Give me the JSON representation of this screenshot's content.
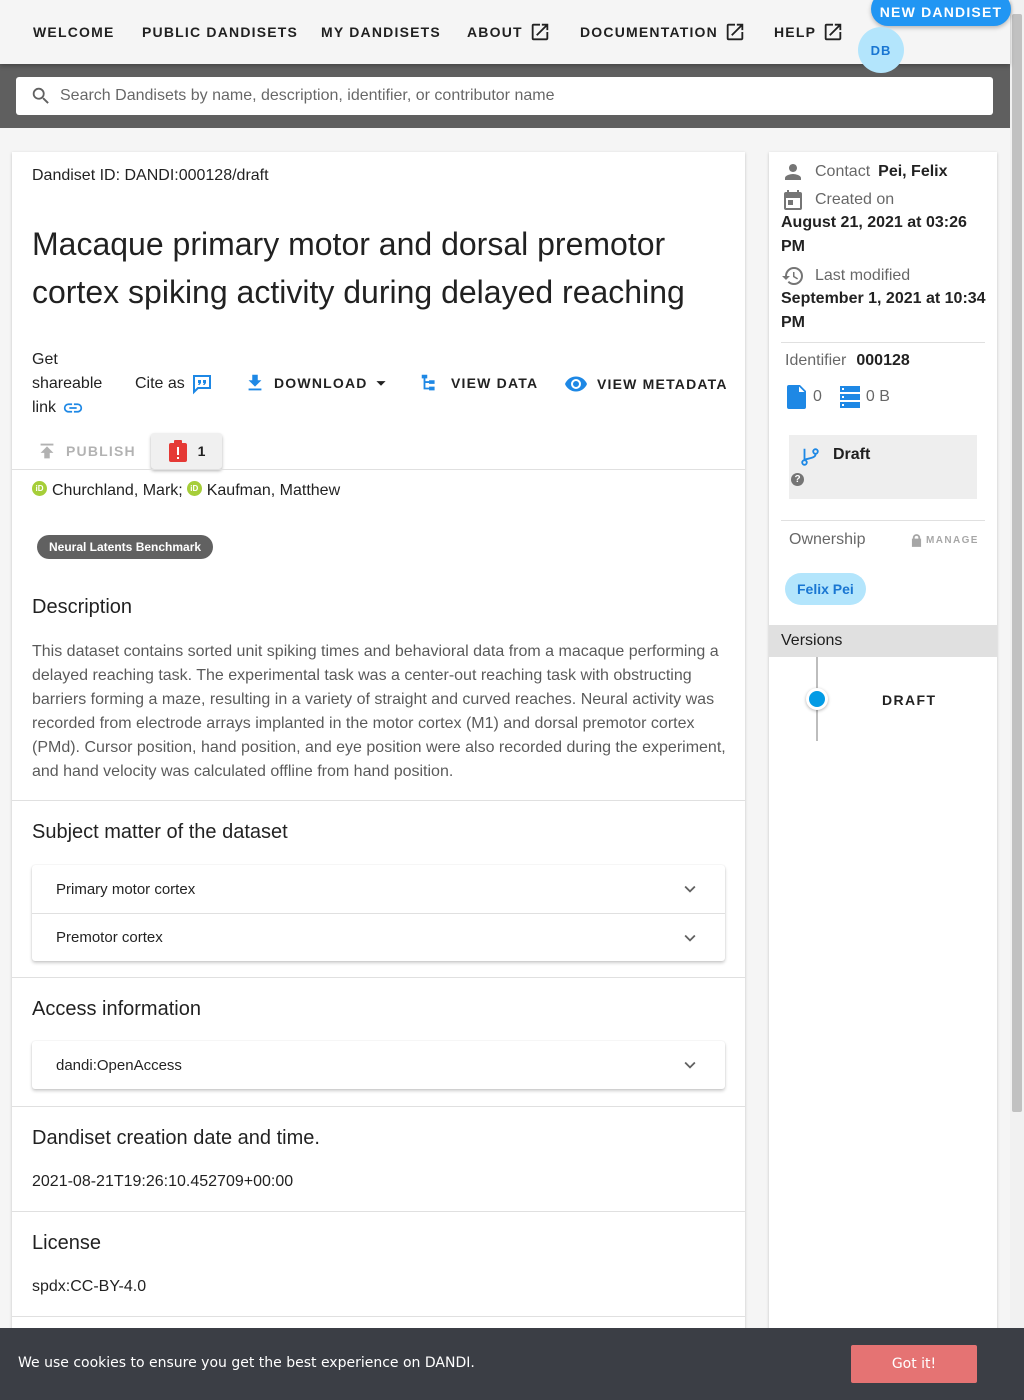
{
  "nav": {
    "items": [
      {
        "label": "WELCOME"
      },
      {
        "label": "PUBLIC DANDISETS"
      },
      {
        "label": "MY DANDISETS"
      },
      {
        "label": "ABOUT"
      },
      {
        "label": "DOCUMENTATION"
      },
      {
        "label": "HELP"
      }
    ],
    "new_button": "NEW DANDISET",
    "avatar_initials": "DB"
  },
  "search": {
    "placeholder": "Search Dandisets by name, description, identifier, or contributor name"
  },
  "dandiset": {
    "id_label": "Dandiset ID: DANDI:000128/draft",
    "title": "Macaque primary motor and dorsal premotor cortex spiking activity during delayed reaching",
    "actions": {
      "share": "Get shareable link",
      "cite": "Cite as",
      "download": "DOWNLOAD",
      "view_data": "VIEW DATA",
      "view_metadata": "VIEW METADATA",
      "publish": "PUBLISH",
      "error_count": "1"
    },
    "contributors": [
      "Churchland, Mark;",
      "Kaufman, Matthew"
    ],
    "keyword": "Neural Latents Benchmark",
    "description_heading": "Description",
    "description": "This dataset contains sorted unit spiking times and behavioral data from a macaque performing a delayed reaching task. The experimental task was a center-out reaching task with obstructing barriers forming a maze, resulting in a variety of straight and curved reaches. Neural activity was recorded from electrode arrays implanted in the motor cortex (M1) and dorsal premotor cortex (PMd). Cursor position, hand position, and eye position were also recorded during the experiment, and hand velocity was calculated offline from hand position.",
    "subject_heading": "Subject matter of the dataset",
    "subjects": [
      "Primary motor cortex",
      "Premotor cortex"
    ],
    "access_heading": "Access information",
    "access": [
      "dandi:OpenAccess"
    ],
    "created_heading": "Dandiset creation date and time.",
    "created_value": "2021-08-21T19:26:10.452709+00:00",
    "license_heading": "License",
    "license_value": "spdx:CC-BY-4.0"
  },
  "side": {
    "contact_label": "Contact",
    "contact_value": "Pei, Felix",
    "created_label": "Created on",
    "created_value": "August 21, 2021 at 03:26 PM",
    "modified_label": "Last modified",
    "modified_value": "September 1, 2021 at 10:34 PM",
    "identifier_label": "Identifier",
    "identifier_value": "000128",
    "file_count": "0",
    "size": "0 B",
    "draft_label": "Draft",
    "ownership_label": "Ownership",
    "manage_label": "MANAGE",
    "owner": "Felix Pei",
    "versions_label": "Versions",
    "version_draft": "DRAFT"
  },
  "cookie": {
    "text": "We use cookies to ensure you get the best experience on DANDI.",
    "button": "Got it!"
  },
  "colors": {
    "accent": "#2196f3",
    "link_icon": "#1e88e5",
    "error": "#e53935",
    "orcid": "#a6ce39",
    "cookie_bg": "#3b3e45",
    "cookie_btn": "#e57373"
  }
}
